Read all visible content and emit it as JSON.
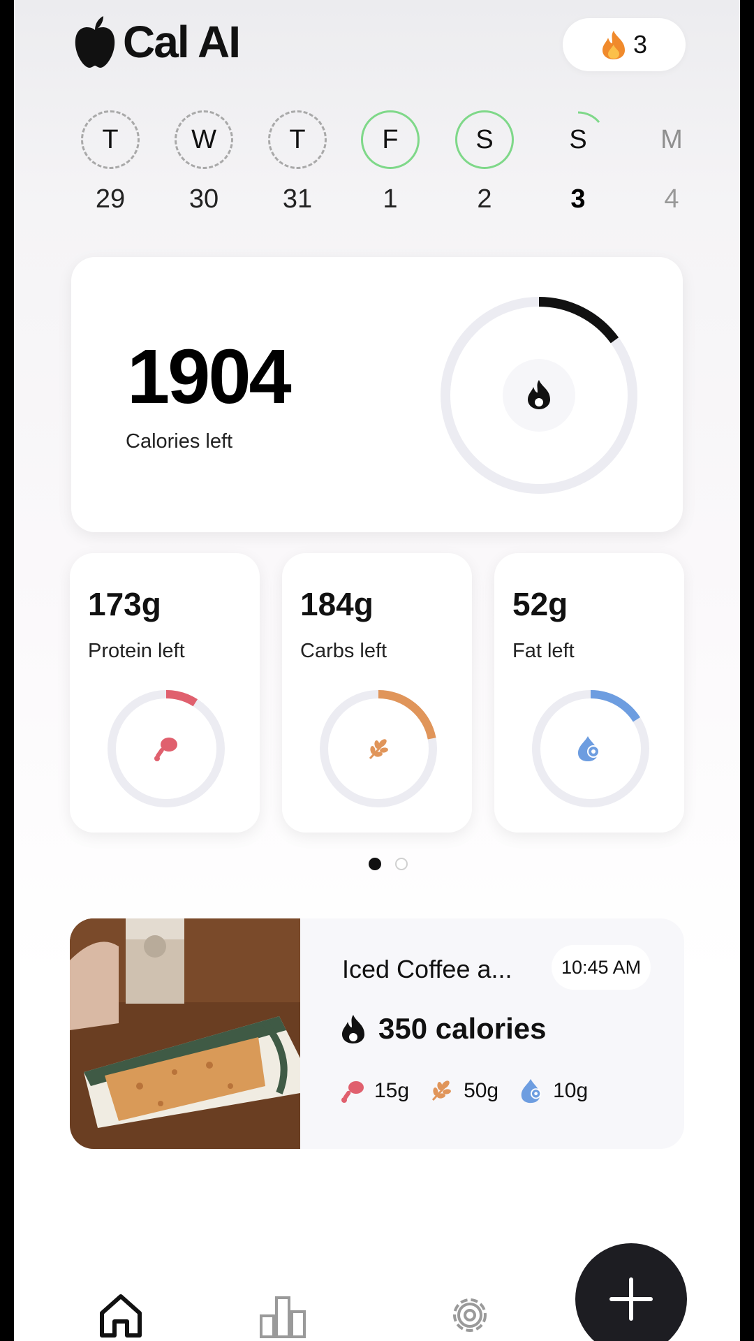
{
  "app": {
    "title": "Cal AI",
    "logo_icon": "apple-icon"
  },
  "streak": {
    "count": "3",
    "icon": "flame-icon"
  },
  "week": [
    {
      "letter": "T",
      "date": "29",
      "state": "dashed"
    },
    {
      "letter": "W",
      "date": "30",
      "state": "dashed"
    },
    {
      "letter": "T",
      "date": "31",
      "state": "dashed"
    },
    {
      "letter": "F",
      "date": "1",
      "state": "complete"
    },
    {
      "letter": "S",
      "date": "2",
      "state": "complete"
    },
    {
      "letter": "S",
      "date": "3",
      "state": "selected"
    },
    {
      "letter": "M",
      "date": "4",
      "state": "future"
    }
  ],
  "calories": {
    "value": "1904",
    "label": "Calories left",
    "progress": 0.15,
    "color": "#111111"
  },
  "macros": [
    {
      "key": "protein",
      "value": "173g",
      "label": "Protein left",
      "progress": 0.09,
      "color": "#e0606e",
      "icon": "drumstick-icon"
    },
    {
      "key": "carbs",
      "value": "184g",
      "label": "Carbs left",
      "progress": 0.22,
      "color": "#e0955a",
      "icon": "wheat-icon"
    },
    {
      "key": "fat",
      "value": "52g",
      "label": "Fat left",
      "progress": 0.16,
      "color": "#6d9de0",
      "icon": "oil-drop-icon"
    }
  ],
  "pager": {
    "pages": 2,
    "active": 0
  },
  "meal": {
    "title": "Iced Coffee a...",
    "time": "10:45 AM",
    "calories": "350 calories",
    "protein": "15g",
    "carbs": "50g",
    "fat": "10g"
  },
  "nav": {
    "items": [
      "home-icon",
      "chart-icon",
      "settings-icon"
    ],
    "fab": "plus-icon"
  }
}
